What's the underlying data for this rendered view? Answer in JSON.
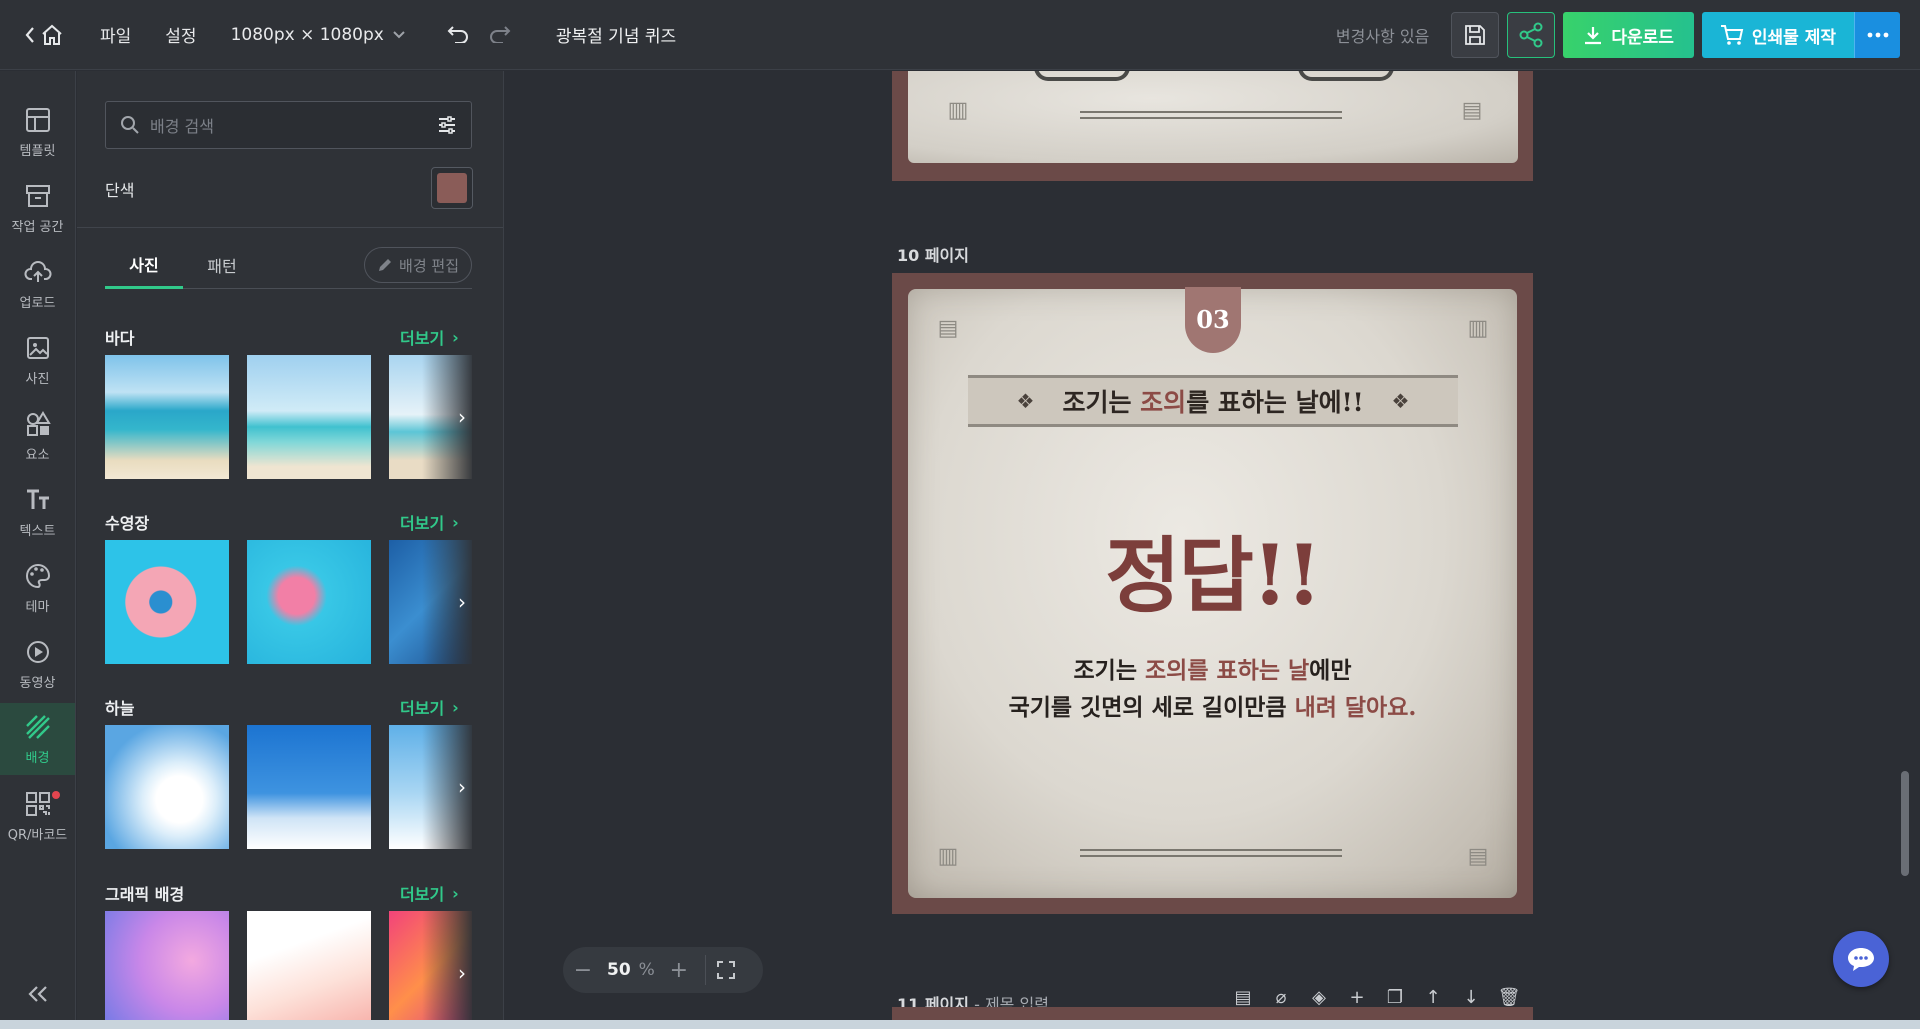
{
  "topbar": {
    "menu_file": "파일",
    "menu_settings": "설정",
    "canvas_size": "1080px × 1080px",
    "doc_title": "광복절 기념 퀴즈",
    "changes_status": "변경사항 있음",
    "download_label": "다운로드",
    "print_label": "인쇄물 제작"
  },
  "sidenav": {
    "items": [
      {
        "label": "템플릿",
        "icon": "template-icon"
      },
      {
        "label": "작업 공간",
        "icon": "workspace-icon"
      },
      {
        "label": "업로드",
        "icon": "upload-icon"
      },
      {
        "label": "사진",
        "icon": "photo-icon"
      },
      {
        "label": "요소",
        "icon": "elements-icon"
      },
      {
        "label": "텍스트",
        "icon": "text-icon"
      },
      {
        "label": "테마",
        "icon": "palette-icon"
      },
      {
        "label": "동영상",
        "icon": "video-icon"
      },
      {
        "label": "배경",
        "icon": "background-icon",
        "active": true
      },
      {
        "label": "QR/바코드",
        "icon": "qr-icon",
        "has_notification": true
      }
    ]
  },
  "panel": {
    "search_placeholder": "배경 검색",
    "solid_label": "단색",
    "solid_color": "#8a5c58",
    "tabs": [
      "사진",
      "패턴"
    ],
    "active_tab": "사진",
    "bg_edit_label": "배경 편집",
    "more_label": "더보기",
    "categories": [
      {
        "title": "바다"
      },
      {
        "title": "수영장"
      },
      {
        "title": "하늘"
      },
      {
        "title": "그래픽 배경"
      }
    ]
  },
  "canvas": {
    "page10_label": "10 페이지",
    "page11_label": "11 페이지",
    "page11_subtitle": " - 제목 입력",
    "zoom_value": "50",
    "zoom_unit": "%"
  },
  "slide": {
    "badge_number": "03",
    "banner_pre": "조기는 ",
    "banner_hl": "조의",
    "banner_post": "를 표하는 날에!!",
    "answer": "정답!!",
    "body_line1_pre": "조기는 ",
    "body_line1_hl": "조의를 표하는 날",
    "body_line1_post": "에만",
    "body_line2_pre": "국기를 깃면의 세로 길이만큼 ",
    "body_line2_hl": "내려 달아요."
  },
  "colors": {
    "accent_green": "#31c98a",
    "download_green": "#38d26b",
    "print_cyan": "#1ab5d6",
    "page_border": "#6b4a48",
    "answer_red": "#7c3e3b"
  }
}
